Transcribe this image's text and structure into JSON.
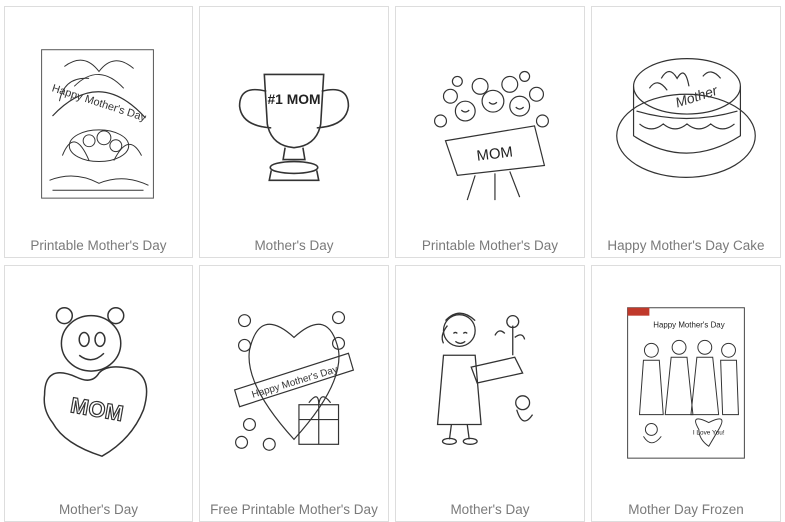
{
  "cards": [
    {
      "title": "Printable Mother's Day",
      "image_text": "Happy Mother's Day"
    },
    {
      "title": "Mother's Day",
      "image_text": "#1 MOM"
    },
    {
      "title": "Printable Mother's Day",
      "image_text": "MOM"
    },
    {
      "title": "Happy Mother's Day Cake",
      "image_text": "Mother"
    },
    {
      "title": "Mother's Day",
      "image_text": "MOM"
    },
    {
      "title": "Free Printable Mother's Day",
      "image_text": "Happy Mother's Day"
    },
    {
      "title": "Mother's Day",
      "image_text": ""
    },
    {
      "title": "Mother Day Frozen",
      "image_text": "Happy Mother's Day",
      "image_text_2": "I Love You!"
    }
  ],
  "colors": {
    "border": "#dddddd",
    "label": "#7a7a7a",
    "line_art": "#333333"
  }
}
